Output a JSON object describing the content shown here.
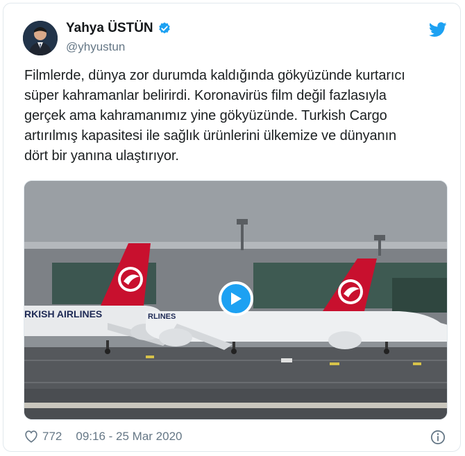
{
  "author": {
    "name": "Yahya ÜSTÜN",
    "handle": "@yhyustun"
  },
  "tweet": {
    "lines": [
      "Filmlerde, dünya zor durumda kaldığında gökyüzünde kurtarıcı",
      "süper kahramanlar belirirdi. Koronavirüs film değil fazlasıyla",
      "gerçek ama kahramanımız yine gökyüzünde. Turkish Cargo",
      "artırılmış kapasitesi ile sağlık ürünlerini ülkemize ve dünyanın",
      "dört bir yanına ulaştırıyor."
    ]
  },
  "media": {
    "airline_text": "RKISH AIRLINES",
    "airline_text_2": "RLINES"
  },
  "footer": {
    "likes": "772",
    "timestamp": "09:16 - 25 Mar 2020"
  },
  "colors": {
    "accent": "#1da1f2",
    "text": "#14171a",
    "muted": "#657786",
    "airline_red": "#c8102e"
  }
}
